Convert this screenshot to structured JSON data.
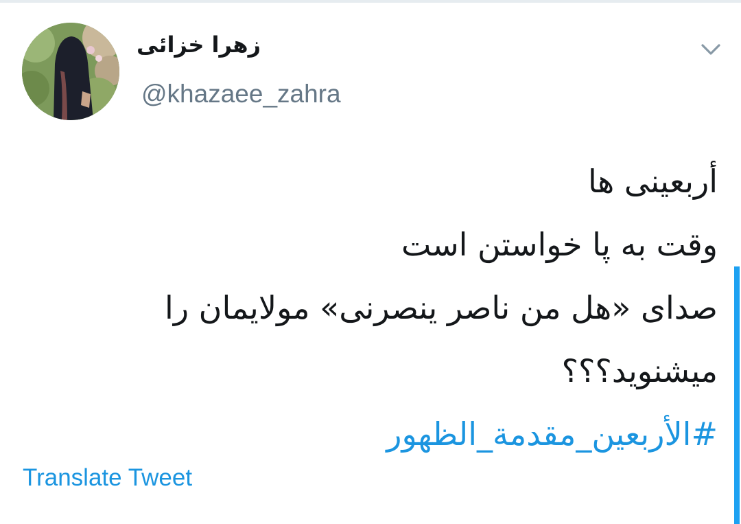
{
  "tweet": {
    "author": {
      "display_name": "زهرا خزائی",
      "handle": "@khazaee_zahra",
      "avatar_icon": "avatar-photo-woman-in-chador"
    },
    "menu_icon": "chevron-down-icon",
    "lines": [
      "أربعینی ها",
      "وقت به پا خواستن است",
      "صدای  «هل من ناصر ینصرنی» مولایمان را",
      "میشنوید؟؟؟"
    ],
    "hashtag": "#الأربعین_مقدمة_الظهور",
    "translate_label": "Translate Tweet"
  },
  "colors": {
    "text": "#14171a",
    "secondary_text": "#657786",
    "link": "#1b95e0",
    "accent": "#1da1f2",
    "divider": "#e6ecf0"
  }
}
